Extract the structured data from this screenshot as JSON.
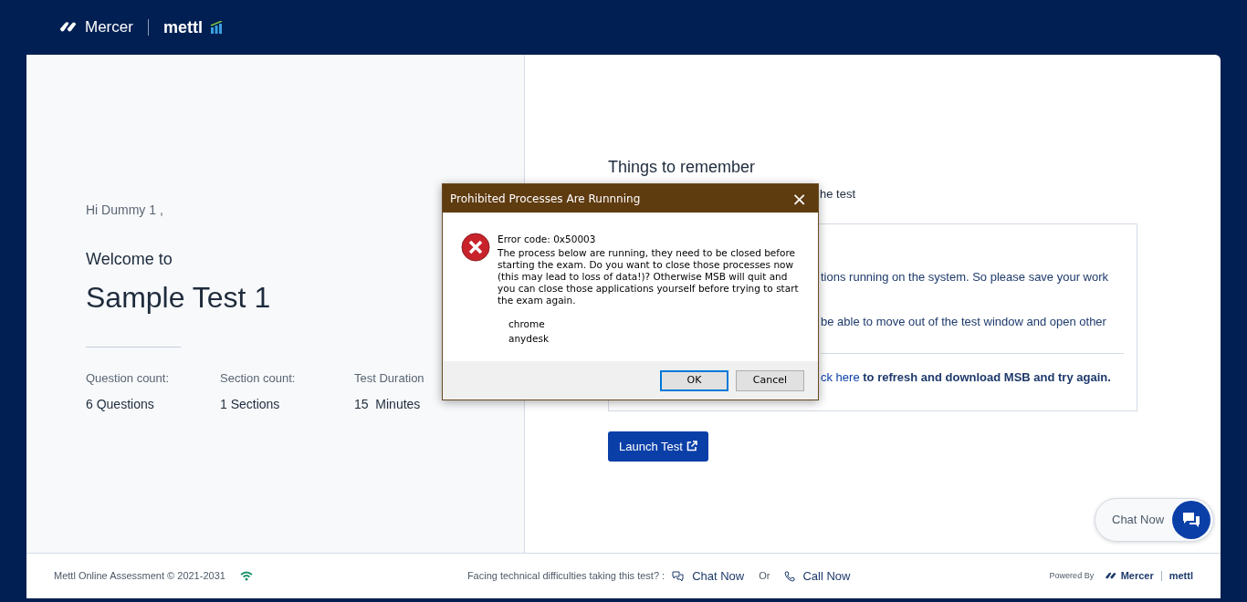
{
  "header": {
    "brand": "Mercer",
    "product": "mettl"
  },
  "welcome": {
    "greeting": "Hi Dummy 1 ,",
    "intro": "Welcome to",
    "test_name": "Sample Test 1",
    "stats": [
      {
        "label": "Question count:",
        "value": "6 Questions"
      },
      {
        "label": "Section count:",
        "value": "1 Sections"
      },
      {
        "label": "Test Duration",
        "value": "15  Minutes"
      }
    ]
  },
  "instructions": {
    "title": "Things to remember",
    "line_1": "he test",
    "notes": [
      "tions running on the system. So please save your work",
      "be able to move out of the test window and open other"
    ],
    "refresh": {
      "link": "ck here",
      "text": " to refresh and download MSB and try again."
    },
    "launch_button": "Launch Test"
  },
  "dialog": {
    "title": "Prohibited Processes Are Runnning",
    "close": "×",
    "error_code": "Error code: 0x50003",
    "message": "The process below are running, they need to be closed before starting the exam. Do you want to close those processes now (this may lead to loss of data!)? Otherwise MSB will quit and you can close those applications yourself before trying to start the exam again.",
    "processes": [
      "chrome",
      "anydesk"
    ],
    "buttons": [
      {
        "label": "OK",
        "selected": true
      },
      {
        "label": "Cancel",
        "selected": false
      }
    ]
  },
  "chat_widget": {
    "label": "Chat Now"
  },
  "footer": {
    "copyright": "Mettl Online Assessment © 2021-2031",
    "help_text": "Facing technical difficulties taking this test? :",
    "chat": "Chat Now",
    "or": "Or",
    "call": "Call Now",
    "powered_by": "Powered By",
    "brand": "Mercer",
    "product": "mettl"
  }
}
